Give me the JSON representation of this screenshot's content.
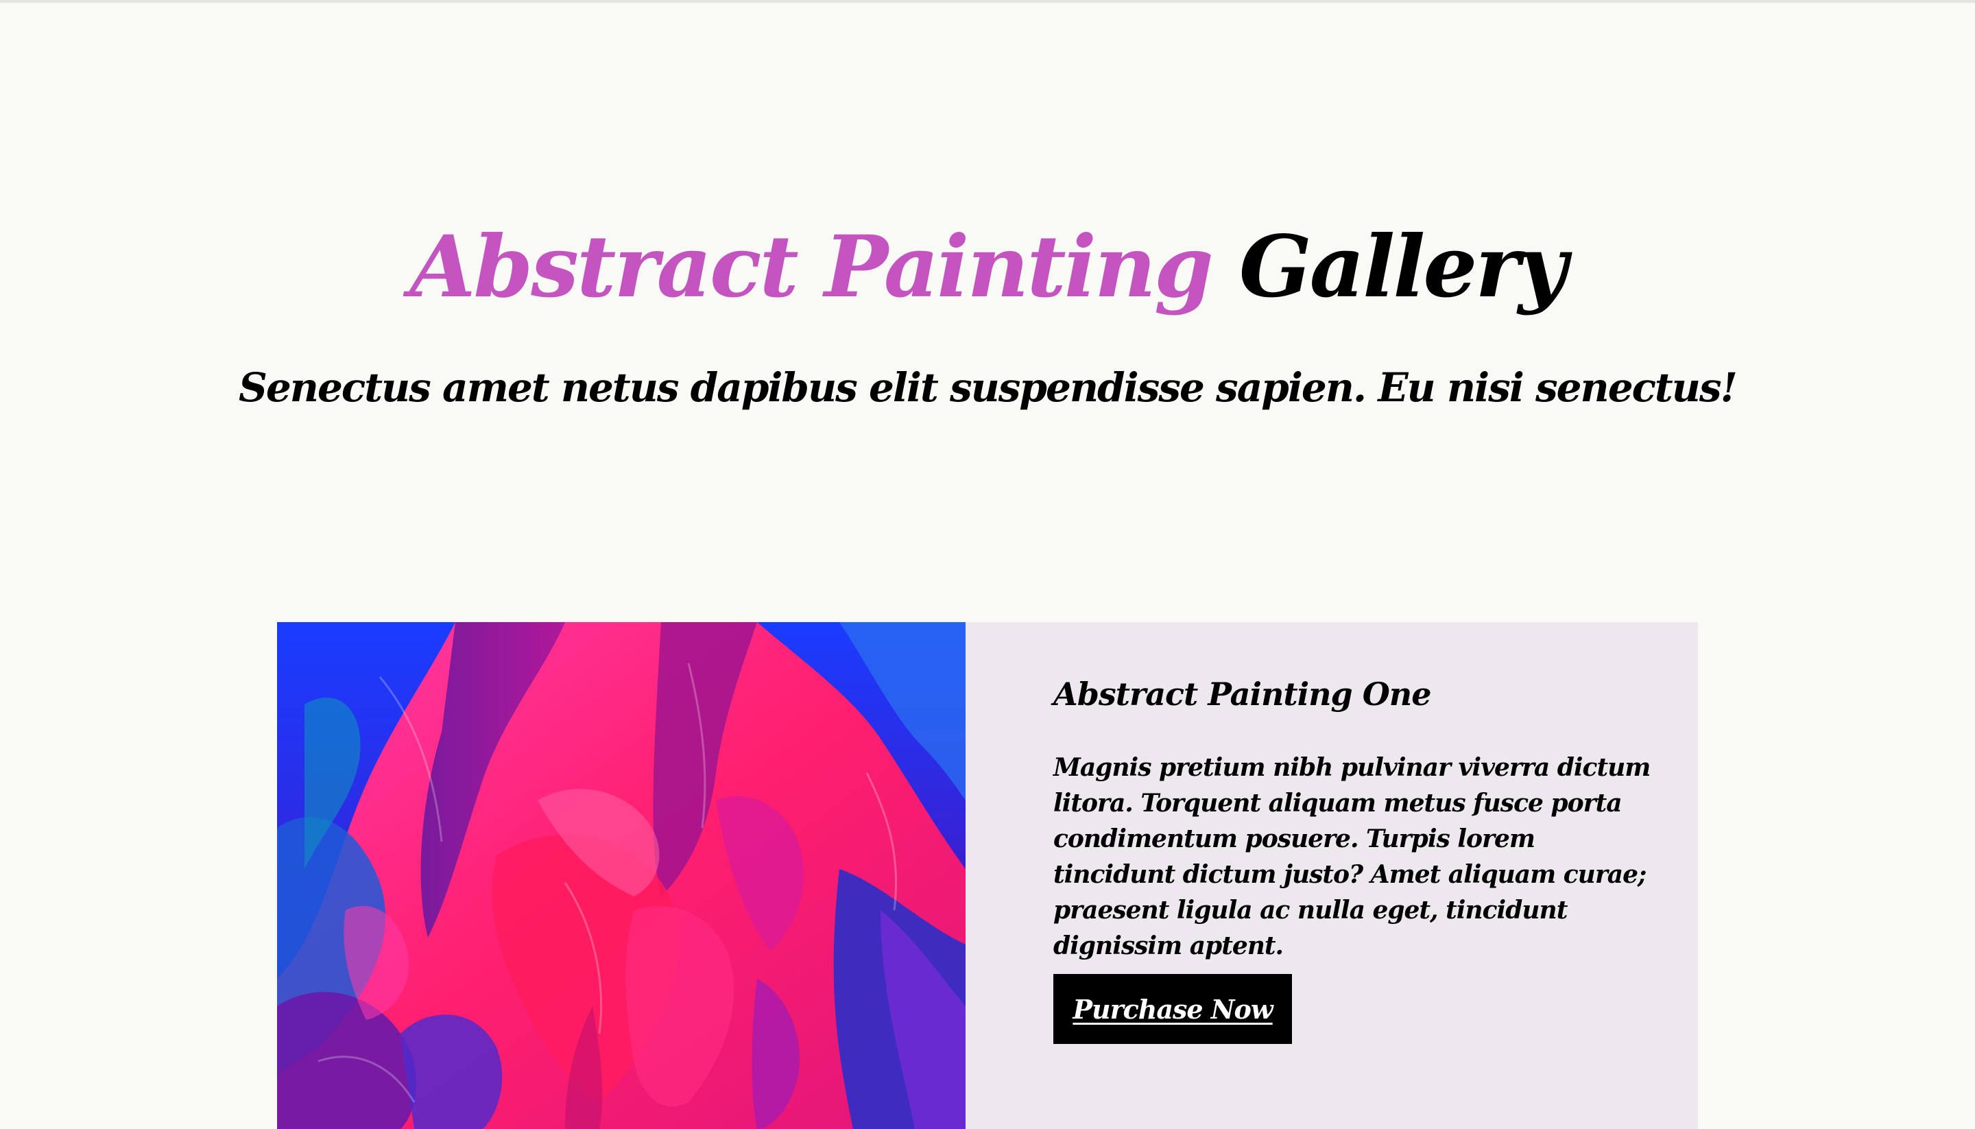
{
  "hero": {
    "title_accent": "Abstract Painting",
    "title_rest": "Gallery",
    "subtitle": "Senectus amet netus dapibus elit suspendisse sapien. Eu nisi senectus!"
  },
  "product": {
    "image_description": "abstract-painting-pink-blue",
    "title": "Abstract Painting One",
    "description": "Magnis pretium nibh pulvinar viverra dictum litora. Torquent aliquam metus fusce porta condimentum posuere. Turpis lorem tincidunt dictum justo? Amet aliquam curae; praesent ligula ac nulla eget, tincidunt dignissim aptent.",
    "button_label": "Purchase Now"
  },
  "colors": {
    "page_background": "#f9f9f5",
    "accent": "#c455c0",
    "card_background": "#ede8ed",
    "button_background": "#000000",
    "button_text": "#ffffff"
  }
}
